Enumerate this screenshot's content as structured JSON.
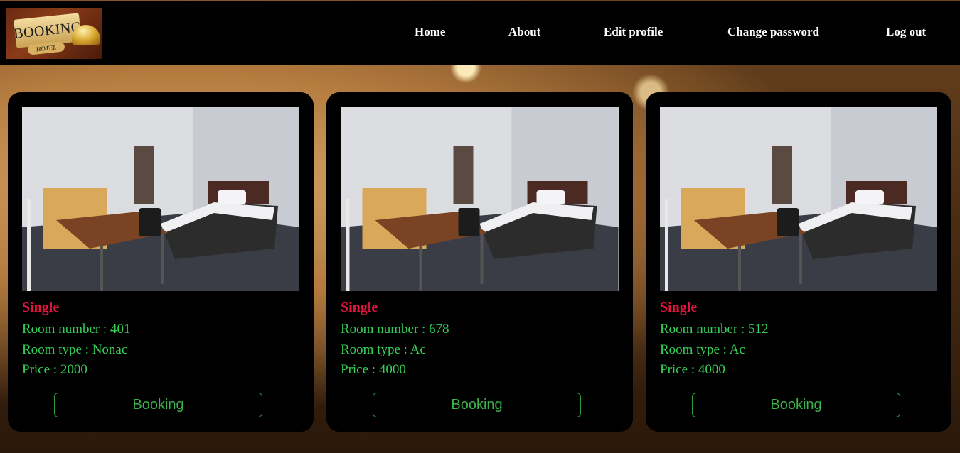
{
  "header": {
    "logo": {
      "text": "BOOKING",
      "subtext": "HOTEL"
    },
    "nav": [
      {
        "label": "Home"
      },
      {
        "label": "About"
      },
      {
        "label": "Edit profile"
      },
      {
        "label": "Change password"
      },
      {
        "label": "Log out"
      }
    ]
  },
  "rooms": [
    {
      "category": "Single",
      "room_number": "Room number : 401",
      "room_type": "Room type : Nonac",
      "price": "Price : 2000",
      "button": "Booking"
    },
    {
      "category": "Single",
      "room_number": "Room number : 678",
      "room_type": "Room type : Ac",
      "price": "Price : 4000",
      "button": "Booking"
    },
    {
      "category": "Single",
      "room_number": "Room number : 512",
      "room_type": "Room type : Ac",
      "price": "Price : 4000",
      "button": "Booking"
    }
  ],
  "colors": {
    "title": "#e0143c",
    "details": "#34d058",
    "button": "#3cb24a",
    "card_bg": "#000000",
    "header_bg": "#000000"
  }
}
